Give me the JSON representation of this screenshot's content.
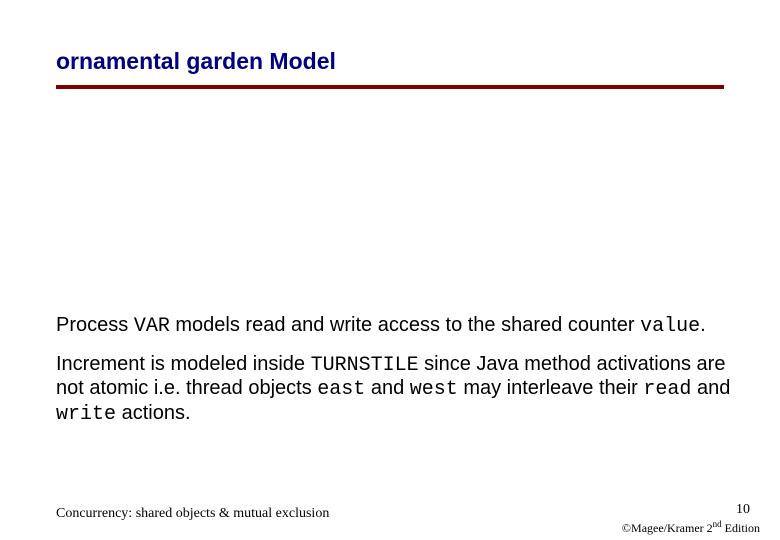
{
  "title": "ornamental garden Model",
  "para1": {
    "t1": "Process ",
    "c1": "VAR",
    "t2": " models read and write access to the shared counter ",
    "c2": "value",
    "t3": "."
  },
  "para2": {
    "t1": "Increment is modeled inside ",
    "c1": "TURNSTILE",
    "t2": " since Java method activations are not atomic i.e. thread objects ",
    "c2": "east",
    "t3": " and ",
    "c3": "west",
    "t4": " may interleave their ",
    "c4": "read",
    "t5": " and ",
    "c5": "write",
    "t6": " actions."
  },
  "footer": {
    "left": "Concurrency: shared objects & mutual exclusion",
    "pagenum": "10",
    "copyright_pre": "©Magee/Kramer 2",
    "copyright_sup": "nd",
    "copyright_post": " Edition"
  }
}
